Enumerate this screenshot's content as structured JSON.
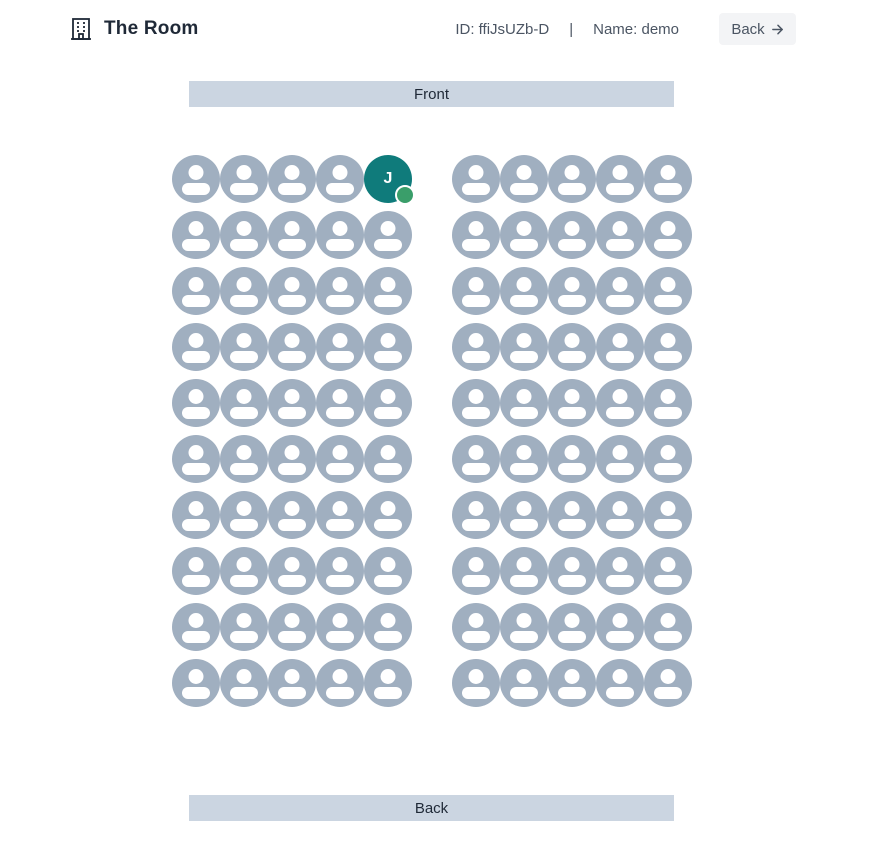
{
  "header": {
    "title": "The Room",
    "icon": "building-icon",
    "id_text": "ID: ffiJsUZb-D",
    "separator": "|",
    "name_text": "Name: demo",
    "back_label": "Back",
    "back_icon": "arrow-right-icon"
  },
  "room": {
    "front_label": "Front",
    "back_label": "Back",
    "rows": 10,
    "columns_per_side": 5,
    "sides": [
      "left",
      "right"
    ],
    "seat_color": "#a0afc0",
    "occupied_seats": [
      {
        "side": "left",
        "row": 1,
        "column": 5,
        "initial": "J",
        "color": "#0f7b7b",
        "status": "online",
        "status_color": "#3a9e6a"
      }
    ]
  },
  "colors": {
    "bar_background": "#cbd5e1",
    "button_background": "#f3f4f6",
    "text_primary": "#1f2937",
    "text_secondary": "#4b5563"
  }
}
